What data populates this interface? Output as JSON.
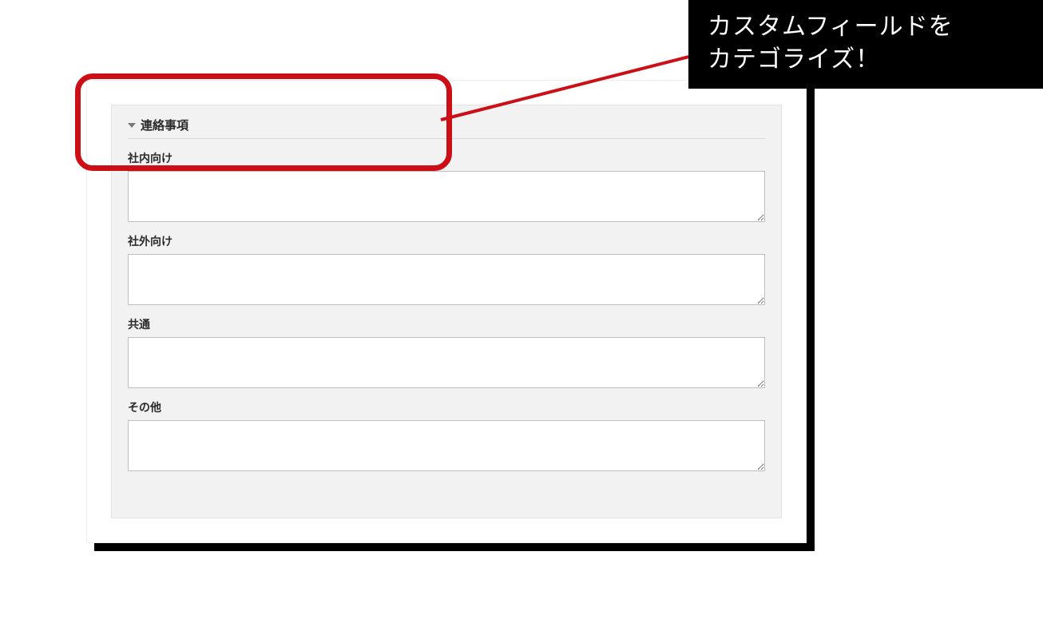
{
  "callout": {
    "line1": "カスタムフィールドを",
    "line2": "カテゴライズ！"
  },
  "section": {
    "title": "連絡事項",
    "fields": [
      {
        "label": "社内向け",
        "value": ""
      },
      {
        "label": "社外向け",
        "value": ""
      },
      {
        "label": "共通",
        "value": ""
      },
      {
        "label": "その他",
        "value": ""
      }
    ]
  },
  "colors": {
    "highlight": "#cc0f16",
    "panel_bg": "#f2f2f2"
  }
}
